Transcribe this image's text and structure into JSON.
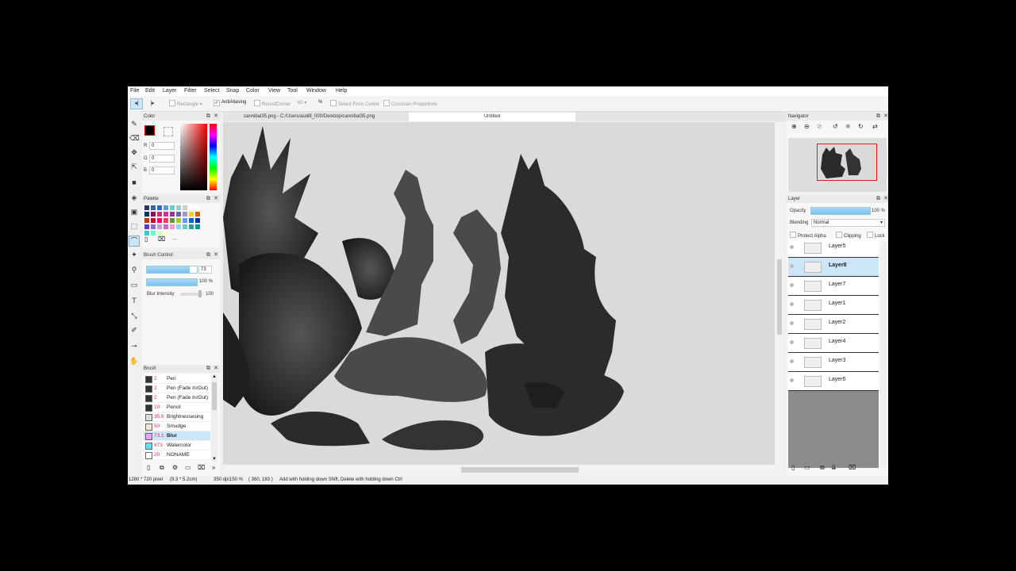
{
  "menu": [
    "File",
    "Edit",
    "Layer",
    "Filter",
    "Select",
    "Snap",
    "Color",
    "View",
    "Tool",
    "Window",
    "Help"
  ],
  "options": {
    "shape": "Rectangle",
    "antialiasing": "AntiAliasing",
    "roundcorner": "RoundCorner",
    "roundcorner_value": "60",
    "percent": "%",
    "from_center": "Select From Center",
    "constrain": "Constrain Proportions"
  },
  "tabs": [
    "cannibal35.png - C:/Users/audi8_000/Desktop/cannibal35.png",
    "Untitled"
  ],
  "color_panel": {
    "title": "Color",
    "r_label": "R",
    "r_value": "0",
    "g_label": "G",
    "g_value": "0",
    "b_label": "B",
    "b_value": "0",
    "fg_color": "#000000"
  },
  "palette_panel": {
    "title": "Palette",
    "swatches": [
      "#333366",
      "#336699",
      "#3366cc",
      "#6699cc",
      "#66cccc",
      "#99cccc",
      "#cccccc",
      "#ffffff",
      "#ffffff",
      "#003366",
      "#990066",
      "#cc3366",
      "#cc3399",
      "#993399",
      "#666699",
      "#9999cc",
      "#ffcc33",
      "#cc6600",
      "#cc3300",
      "#cc0033",
      "#ff0066",
      "#ff3366",
      "#669933",
      "#99cc33",
      "#6699ff",
      "#0066cc",
      "#003399",
      "#6633cc",
      "#9966cc",
      "#cc99cc",
      "#cc66cc",
      "#ff99cc",
      "#99ccff",
      "#66cccc",
      "#339999",
      "#009999",
      "#33cccc",
      "#66ffcc",
      "#ccffcc",
      "#ffffcc"
    ],
    "more": "..."
  },
  "brush_control": {
    "title": "Brush Control",
    "size_value": "73",
    "size_fill": 0.85,
    "opacity_value": "100 %",
    "opacity_fill": 1.0,
    "blur_label": "Blur Intensity",
    "blur_value": "100"
  },
  "brush_panel": {
    "title": "Brush",
    "items": [
      {
        "size": "2",
        "name": "Pen",
        "color": "#333333"
      },
      {
        "size": "2",
        "name": "Pen (Fade In/Out)",
        "color": "#333333"
      },
      {
        "size": "2",
        "name": "Pen (Fade In/Out)",
        "color": "#333333"
      },
      {
        "size": "10",
        "name": "Pencil",
        "color": "#333333"
      },
      {
        "size": "35.6",
        "name": "Brightnessesing",
        "color": "#dddddd"
      },
      {
        "size": "50",
        "name": "Smudge",
        "color": "#f5e6d6"
      },
      {
        "size": "73.1",
        "name": "Blur",
        "color": "#f0a0f0",
        "selected": true
      },
      {
        "size": "673",
        "name": "Watercolor",
        "color": "#66ddee"
      },
      {
        "size": "20",
        "name": "NONAME",
        "color": "#ffffff"
      }
    ]
  },
  "navigator": {
    "title": "Navigator"
  },
  "layer_panel": {
    "title": "Layer",
    "opacity_label": "Opacity",
    "opacity_value": "100 %",
    "opacity_fill": 1.0,
    "blending_label": "Blending",
    "blending_value": "Normal",
    "protect_alpha": "Protect Alpha",
    "clipping": "Clipping",
    "lock": "Lock",
    "layers": [
      {
        "name": "Layer5"
      },
      {
        "name": "Layer8",
        "selected": true
      },
      {
        "name": "Layer7"
      },
      {
        "name": "Layer1"
      },
      {
        "name": "Layer2"
      },
      {
        "name": "Layer4"
      },
      {
        "name": "Layer3"
      },
      {
        "name": "Layer6"
      }
    ]
  },
  "status": {
    "size": "1280 * 720 pixel",
    "dims": "(9.3 * 5.2cm)",
    "dpi": "350 dpi",
    "zoom": "150 %",
    "coords": "( 360, 183 )",
    "hint": "Add with holding down Shift, Delete with holding down Ctrl"
  }
}
